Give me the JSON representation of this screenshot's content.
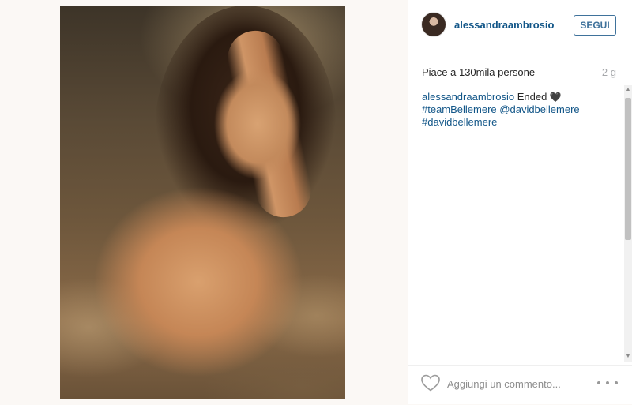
{
  "post": {
    "photo_icon": "post-photo"
  },
  "header": {
    "username": "alessandraambrosio",
    "follow_label": "SEGUI",
    "avatar_icon": "avatar"
  },
  "stats": {
    "likes_text": "Piace a 130mila persone",
    "time_ago": "2 g"
  },
  "caption": {
    "username": "alessandraambrosio",
    "text": "Ended",
    "emoji": "🖤",
    "tags": [
      "#teamBellemere",
      "@davidbellemere",
      "#davidbellemere"
    ]
  },
  "footer": {
    "like_icon": "heart-outline-icon",
    "comment_placeholder": "Aggiungi un commento...",
    "more_icon": "more-options-icon"
  },
  "colors": {
    "link": "#125688",
    "follow": "#3f729b",
    "muted": "#a5a7aa",
    "page_bg": "#fbf8f5"
  }
}
